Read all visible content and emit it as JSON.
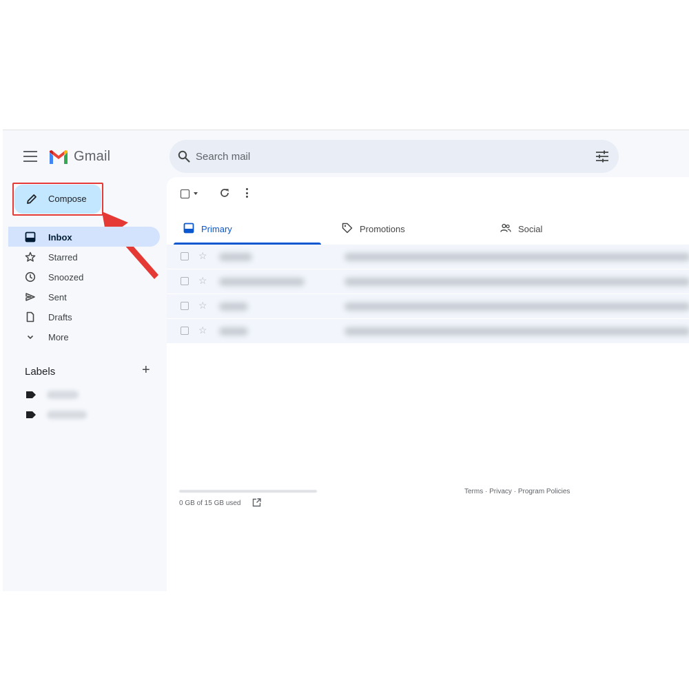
{
  "app": {
    "name": "Gmail"
  },
  "search": {
    "placeholder": "Search mail"
  },
  "compose": {
    "label": "Compose"
  },
  "nav": [
    {
      "label": "Inbox",
      "icon": "inbox-icon",
      "active": true
    },
    {
      "label": "Starred",
      "icon": "star-icon"
    },
    {
      "label": "Snoozed",
      "icon": "clock-icon"
    },
    {
      "label": "Sent",
      "icon": "send-icon"
    },
    {
      "label": "Drafts",
      "icon": "draft-icon"
    },
    {
      "label": "More",
      "icon": "chevron-down-icon"
    }
  ],
  "labels": {
    "heading": "Labels",
    "add": "+"
  },
  "tabs": [
    {
      "label": "Primary",
      "icon": "inbox-icon",
      "active": true
    },
    {
      "label": "Promotions",
      "icon": "tag-icon"
    },
    {
      "label": "Social",
      "icon": "people-icon"
    }
  ],
  "storage": {
    "text": "0 GB of 15 GB used",
    "fraction": 0
  },
  "footer": {
    "terms": "Terms",
    "privacy": "Privacy",
    "policies": "Program Policies",
    "sep": " · "
  },
  "colors": {
    "background": "#f6f8fc",
    "compose": "#c2e7ff",
    "nav_active": "#d3e3fd",
    "accent": "#0b57d0",
    "highlight_annotation": "#e53935"
  }
}
